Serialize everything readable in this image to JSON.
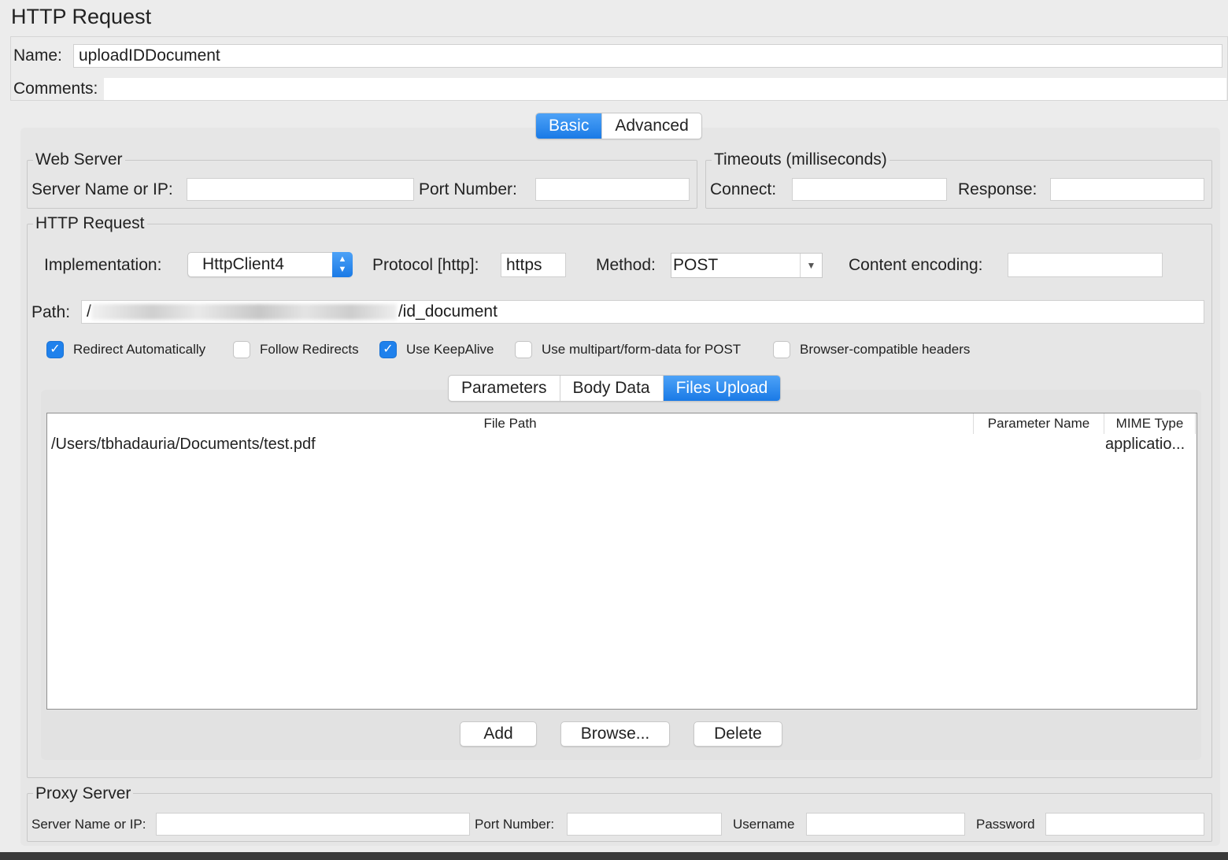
{
  "title": "HTTP Request",
  "name": {
    "label": "Name:",
    "value": "uploadIDDocument"
  },
  "comments": {
    "label": "Comments:",
    "value": ""
  },
  "top_tabs": [
    {
      "label": "Basic",
      "active": true
    },
    {
      "label": "Advanced",
      "active": false
    }
  ],
  "web_server": {
    "legend": "Web Server",
    "server_label": "Server Name or IP:",
    "server_value": "",
    "port_label": "Port Number:",
    "port_value": ""
  },
  "timeouts": {
    "legend": "Timeouts (milliseconds)",
    "connect_label": "Connect:",
    "connect_value": "",
    "response_label": "Response:",
    "response_value": ""
  },
  "http_request": {
    "legend": "HTTP Request",
    "implementation_label": "Implementation:",
    "implementation_value": "HttpClient4",
    "protocol_label": "Protocol [http]:",
    "protocol_value": "https",
    "method_label": "Method:",
    "method_value": "POST",
    "encoding_label": "Content encoding:",
    "encoding_value": "",
    "path_label": "Path:",
    "path_prefix": "/",
    "path_value": "/id_document"
  },
  "checkboxes": [
    {
      "label": "Redirect Automatically",
      "checked": true
    },
    {
      "label": "Follow Redirects",
      "checked": false
    },
    {
      "label": "Use KeepAlive",
      "checked": true
    },
    {
      "label": "Use multipart/form-data for POST",
      "checked": false
    },
    {
      "label": "Browser-compatible headers",
      "checked": false
    }
  ],
  "sub_tabs": [
    {
      "label": "Parameters",
      "active": false
    },
    {
      "label": "Body Data",
      "active": false
    },
    {
      "label": "Files Upload",
      "active": true
    }
  ],
  "files_table": {
    "columns": [
      "File Path",
      "Parameter Name",
      "MIME Type"
    ],
    "rows": [
      {
        "file_path": "/Users/tbhadauria/Documents/test.pdf",
        "parameter_name": "",
        "mime_type": "applicatio..."
      }
    ]
  },
  "buttons": {
    "add": "Add",
    "browse": "Browse...",
    "delete": "Delete"
  },
  "proxy": {
    "legend": "Proxy Server",
    "server_label": "Server Name or IP:",
    "server_value": "",
    "port_label": "Port Number:",
    "port_value": "",
    "username_label": "Username",
    "username_value": "",
    "password_label": "Password",
    "password_value": ""
  },
  "colors": {
    "accent": "#1a7ae6",
    "checkbox": "#1f81ec",
    "background": "#ececec"
  }
}
